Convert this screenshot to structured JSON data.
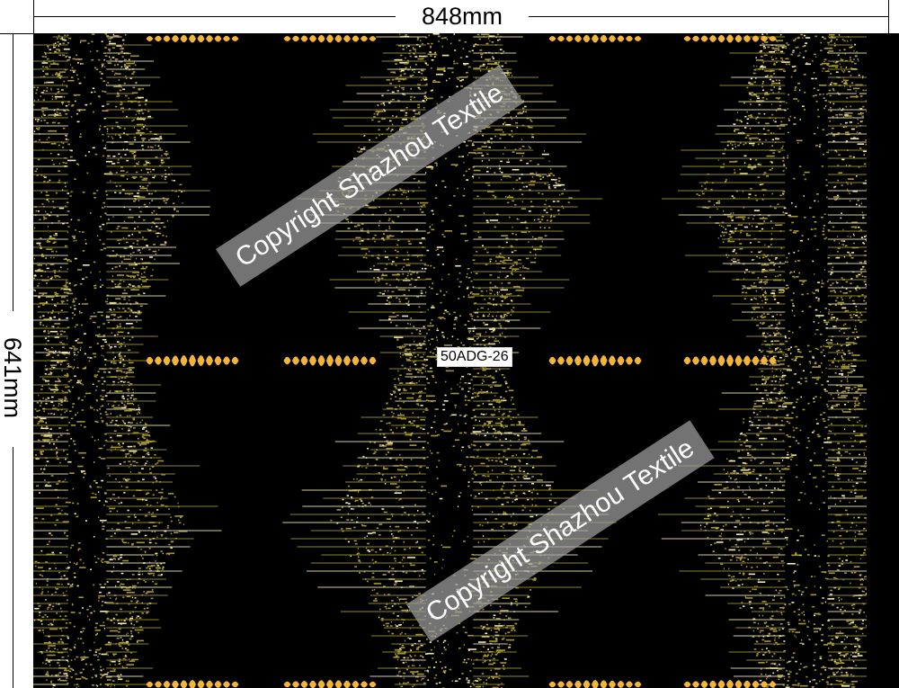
{
  "width_dimension": {
    "label": "848mm"
  },
  "height_dimension": {
    "label": "641mm"
  },
  "design": {
    "code": "50ADG-26",
    "colors": {
      "background": "#000000",
      "sparkle": "#a39632",
      "highlight": "#f0e8b0",
      "accent": "#f2b53a"
    }
  },
  "watermarks": [
    {
      "text": "Copyright Shazhou Textile"
    },
    {
      "text": "Copyright Shazhou Textile"
    }
  ]
}
